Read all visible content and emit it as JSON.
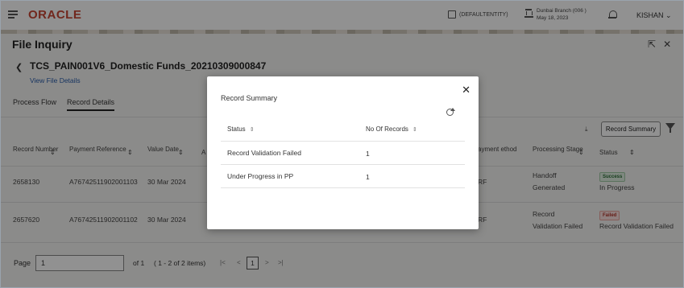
{
  "header": {
    "logo": "ORACLE",
    "entity": "(DEFAULTENTITY)",
    "branch_line1": "Dunbai Branch (006 )",
    "branch_line2": "May 18, 2023",
    "user": "KISHAN"
  },
  "page": {
    "title": "File Inquiry",
    "file_name": "TCS_PAIN001V6_Domestic Funds_20210309000847",
    "view_link": "View File Details"
  },
  "tabs": [
    {
      "label": "Process Flow"
    },
    {
      "label": "Record Details"
    }
  ],
  "toolbar": {
    "record_summary": "Record Summary"
  },
  "table": {
    "headers": {
      "record_number": "Record Number",
      "payment_reference": "Payment Reference",
      "value_date": "Value Date",
      "amount_partial": "A",
      "payment_method_partial": "ayment ethod",
      "processing_stage": "Processing Stage",
      "status": "Status"
    },
    "rows": [
      {
        "record_number": "2658130",
        "payment_reference": "A76742511902001103",
        "value_date": "30 Mar 2024",
        "method_partial": "RF",
        "stage_line1": "Handoff",
        "stage_line2": "Generated",
        "badge": "Success",
        "status": "In Progress"
      },
      {
        "record_number": "2657620",
        "payment_reference": "A76742511902001102",
        "value_date": "30 Mar 2024",
        "method_partial": "RF",
        "stage_line1": "Record",
        "stage_line2": "Validation Failed",
        "badge": "Failed",
        "status": "Record Validation Failed"
      }
    ]
  },
  "pager": {
    "label": "Page",
    "value": "1",
    "of": "of 1",
    "items": "( 1 - 2 of 2 items)",
    "current": "1",
    "first": "|<",
    "prev": "<",
    "next": ">",
    "last": ">|"
  },
  "modal": {
    "title": "Record Summary",
    "col_status": "Status",
    "col_records": "No Of Records",
    "rows": [
      {
        "status": "Record Validation Failed",
        "count": "1"
      },
      {
        "status": "Under Progress in PP",
        "count": "1"
      }
    ]
  },
  "colors": {
    "brand": "#c74634",
    "link": "#2a5dab",
    "overlay": "rgba(0,0,0,0.43)"
  }
}
